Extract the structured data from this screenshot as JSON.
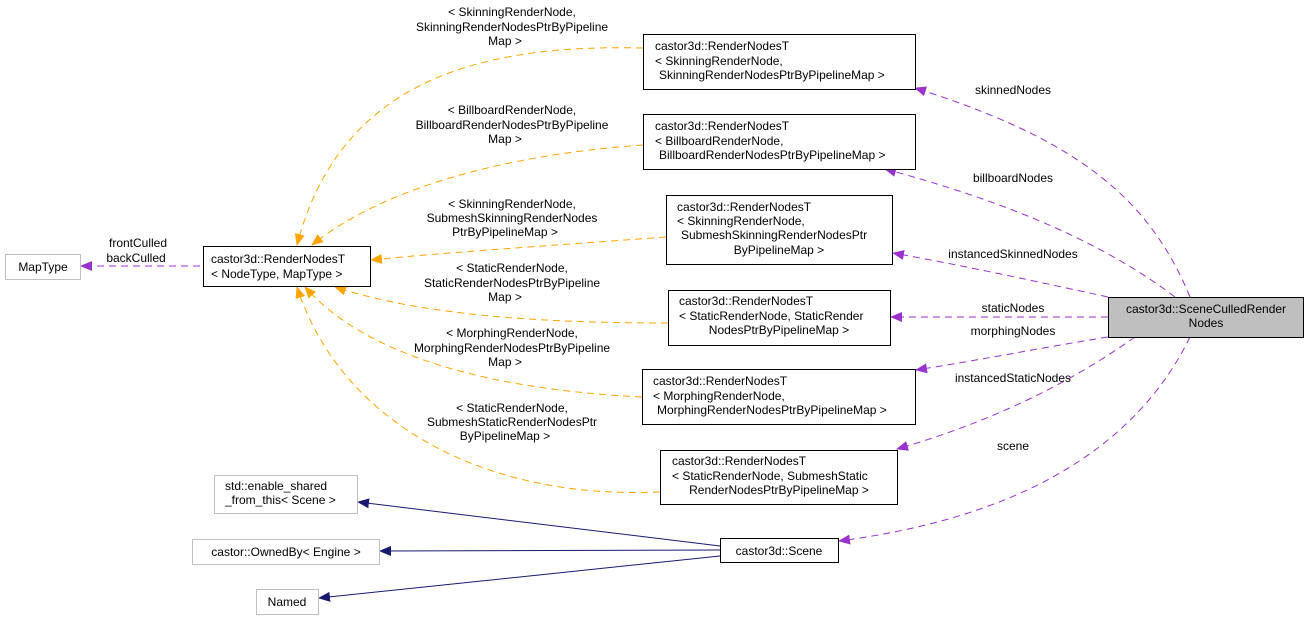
{
  "colors": {
    "template_edge": "#ffa500",
    "member_edge": "#9a32cd",
    "inherit_edge": "#191970",
    "selected_fill": "#bfbfbf"
  },
  "nodes": {
    "maptype": [
      "MapType"
    ],
    "rendernodes": [
      "castor3d::RenderNodesT",
      "< NodeType, MapType >"
    ],
    "skinning": [
      "castor3d::RenderNodesT",
      "< SkinningRenderNode,",
      "SkinningRenderNodesPtrByPipelineMap >"
    ],
    "billboard": [
      "castor3d::RenderNodesT",
      "< BillboardRenderNode,",
      "BillboardRenderNodesPtrByPipelineMap >"
    ],
    "submesh_skinning": [
      "castor3d::RenderNodesT",
      "< SkinningRenderNode,",
      "SubmeshSkinningRenderNodesPtr",
      "ByPipelineMap >"
    ],
    "static": [
      "castor3d::RenderNodesT",
      "< StaticRenderNode, StaticRender",
      "NodesPtrByPipelineMap >"
    ],
    "morphing": [
      "castor3d::RenderNodesT",
      "< MorphingRenderNode,",
      "MorphingRenderNodesPtrByPipelineMap >"
    ],
    "submesh_static": [
      "castor3d::RenderNodesT",
      "< StaticRenderNode, SubmeshStatic",
      "RenderNodesPtrByPipelineMap >"
    ],
    "scene_culled": [
      "castor3d::SceneCulledRender",
      "Nodes"
    ],
    "enable_shared": [
      "std::enable_shared",
      "_from_this< Scene >"
    ],
    "owned_by": [
      "castor::OwnedBy< Engine >"
    ],
    "named": [
      "Named"
    ],
    "scene": [
      "castor3d::Scene"
    ]
  },
  "template_labels": {
    "skinning": [
      "< SkinningRenderNode,",
      "SkinningRenderNodesPtrByPipeline",
      "Map >"
    ],
    "billboard": [
      "< BillboardRenderNode,",
      "BillboardRenderNodesPtrByPipeline",
      "Map >"
    ],
    "submesh_skinning": [
      "< SkinningRenderNode,",
      "SubmeshSkinningRenderNodes",
      "PtrByPipelineMap >"
    ],
    "static": [
      "< StaticRenderNode,",
      "StaticRenderNodesPtrByPipeline",
      "Map >"
    ],
    "morphing": [
      "< MorphingRenderNode,",
      "MorphingRenderNodesPtrByPipeline",
      "Map >"
    ],
    "submesh_static": [
      "< StaticRenderNode,",
      "SubmeshStaticRenderNodesPtr",
      "ByPipelineMap >"
    ]
  },
  "member_labels": {
    "maptype": [
      "frontCulled",
      "backCulled"
    ],
    "skinned": "skinnedNodes",
    "billboard": "billboardNodes",
    "instanced_skinned": "instancedSkinnedNodes",
    "static": "staticNodes",
    "morphing": "morphingNodes",
    "instanced_static": "instancedStaticNodes",
    "scene": "scene"
  }
}
